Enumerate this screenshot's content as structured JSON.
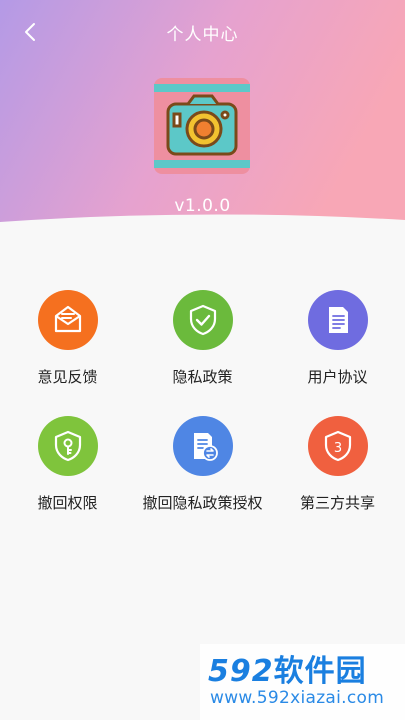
{
  "header": {
    "title": "个人中心",
    "version": "v1.0.0",
    "gradient_start": "#b596e6",
    "gradient_end": "#f6a6b8"
  },
  "menu": [
    {
      "label": "意见反馈",
      "icon": "mail-icon",
      "color": "#f5701f"
    },
    {
      "label": "隐私政策",
      "icon": "shield-check-icon",
      "color": "#6bba3c"
    },
    {
      "label": "用户协议",
      "icon": "document-icon",
      "color": "#6f6ce0"
    },
    {
      "label": "撤回权限",
      "icon": "shield-key-icon",
      "color": "#7fc43c"
    },
    {
      "label": "撤回隐私政策授权",
      "icon": "document-revoke-icon",
      "color": "#4f86e4"
    },
    {
      "label": "第三方共享",
      "icon": "shield-three-icon",
      "color": "#f0603f"
    }
  ],
  "watermark": {
    "brand_number": "592",
    "brand_name": "软件园",
    "url": "www.592xiazai.com"
  }
}
